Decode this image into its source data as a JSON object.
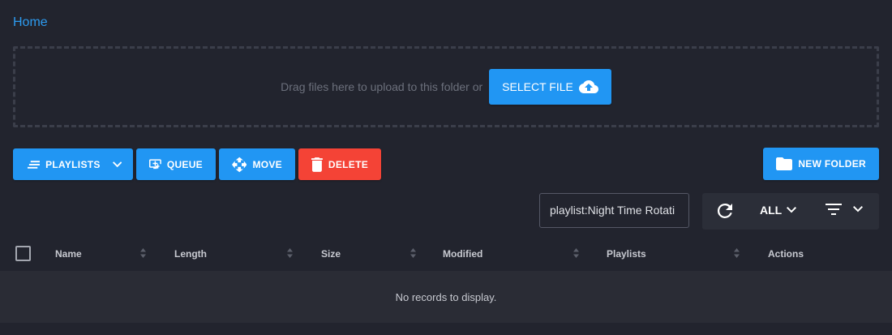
{
  "breadcrumb": {
    "home": "Home"
  },
  "upload": {
    "hint": "Drag files here to upload to this folder or",
    "select_file_label": "SELECT FILE"
  },
  "toolbar": {
    "playlists_label": "PLAYLISTS",
    "queue_label": "QUEUE",
    "move_label": "MOVE",
    "delete_label": "DELETE",
    "new_folder_label": "NEW FOLDER"
  },
  "search": {
    "value": "playlist:Night Time Rotati"
  },
  "filter": {
    "type_value": "ALL"
  },
  "table": {
    "columns": [
      "Name",
      "Length",
      "Size",
      "Modified",
      "Playlists",
      "Actions"
    ],
    "empty_message": "No records to display."
  },
  "colors": {
    "primary": "#2196f3",
    "danger": "#f44336",
    "link": "#2d9bf0",
    "background": "#22242e"
  },
  "icons": {
    "playlists": "playlist-icon",
    "queue": "queue-add-icon",
    "move": "move-arrows-icon",
    "delete": "trash-icon",
    "new_folder": "folder-icon",
    "select_file": "cloud-upload-icon",
    "refresh": "refresh-icon",
    "sort": "sort-icon"
  }
}
